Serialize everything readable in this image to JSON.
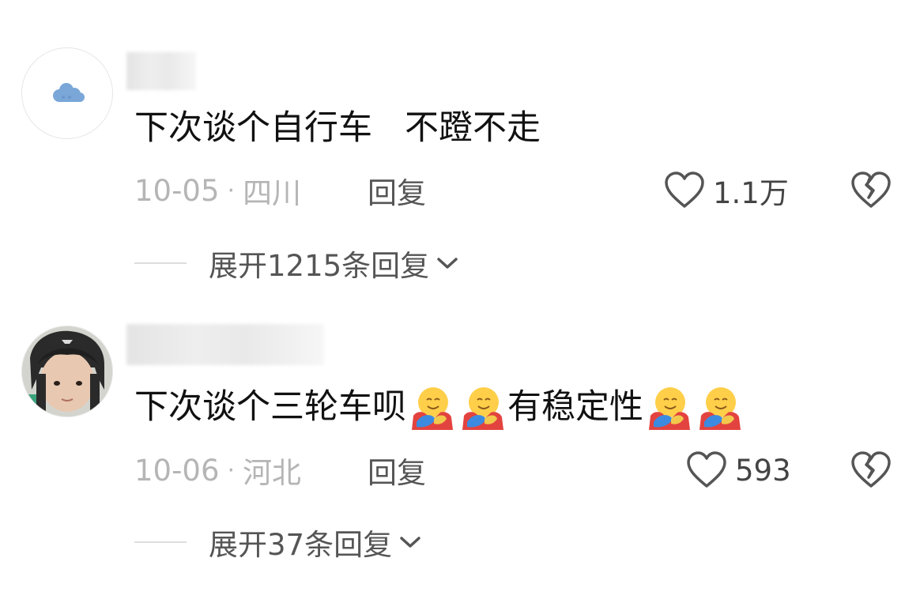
{
  "comments": [
    {
      "text": "下次谈个自行车   不蹬不走",
      "date": "10-05",
      "separator": "·",
      "location": "四川",
      "reply_label": "回复",
      "likes": "1.1万",
      "expand_label": "展开1215条回复",
      "avatar_icon": "cloud-icon"
    },
    {
      "text_parts": [
        "下次谈个三轮车呗",
        "有稳定性"
      ],
      "emoji": "hugging-face-emoji",
      "date": "10-06",
      "separator": "·",
      "location": "河北",
      "reply_label": "回复",
      "likes": "593",
      "expand_label": "展开37条回复",
      "avatar_icon": "child-photo"
    }
  ],
  "colors": {
    "text": "#111111",
    "meta": "#b5b5b5",
    "secondary": "#555555",
    "background": "#ffffff"
  }
}
